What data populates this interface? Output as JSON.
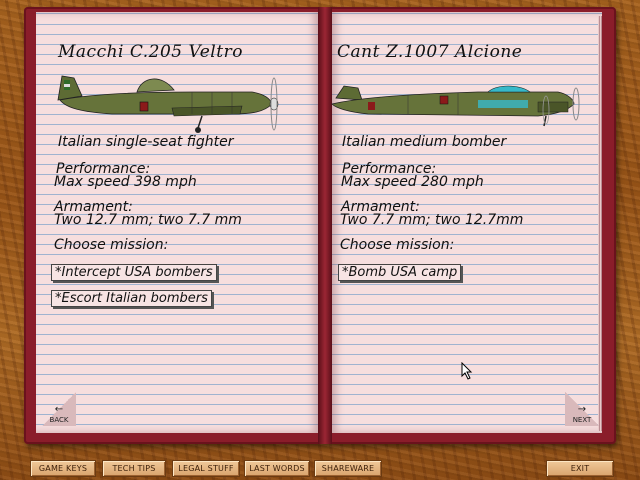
{
  "left_page": {
    "title": "Macchi C.205 Veltro",
    "description": "Italian single-seat fighter",
    "performance_label": "Performance:",
    "max_speed": "Max speed 398 mph",
    "armament_label": "Armament:",
    "armament": "Two 12.7 mm; two 7.7 mm",
    "choose_mission": "Choose mission:",
    "missions": [
      "*Intercept USA bombers",
      "*Escort Italian bombers"
    ]
  },
  "right_page": {
    "title": "Cant Z.1007 Alcione",
    "description": "Italian medium bomber",
    "performance_label": "Performance:",
    "max_speed": "Max speed 280 mph",
    "armament_label": "Armament:",
    "armament": "Two 7.7 mm; two 12.7mm",
    "choose_mission": "Choose mission:",
    "missions": [
      "*Bomb USA camp"
    ]
  },
  "nav": {
    "back_label": "BACK",
    "next_label": "NEXT",
    "back_arrow": "←",
    "next_arrow": "→"
  },
  "bottom_bar": {
    "game_keys": "GAME KEYS",
    "tech_tips": "TECH TIPS",
    "legal_stuff": "LEGAL STUFF",
    "last_words": "LAST WORDS",
    "shareware": "SHAREWARE",
    "exit": "EXIT"
  },
  "colors": {
    "cover": "#8a1d2a",
    "paper": "#f6dede",
    "rule_lines": "#9fb3d0",
    "aircraft_olive": "#5d6b34",
    "canopy_cyan": "#37b9c9",
    "button_tan": "#e4b27c"
  }
}
